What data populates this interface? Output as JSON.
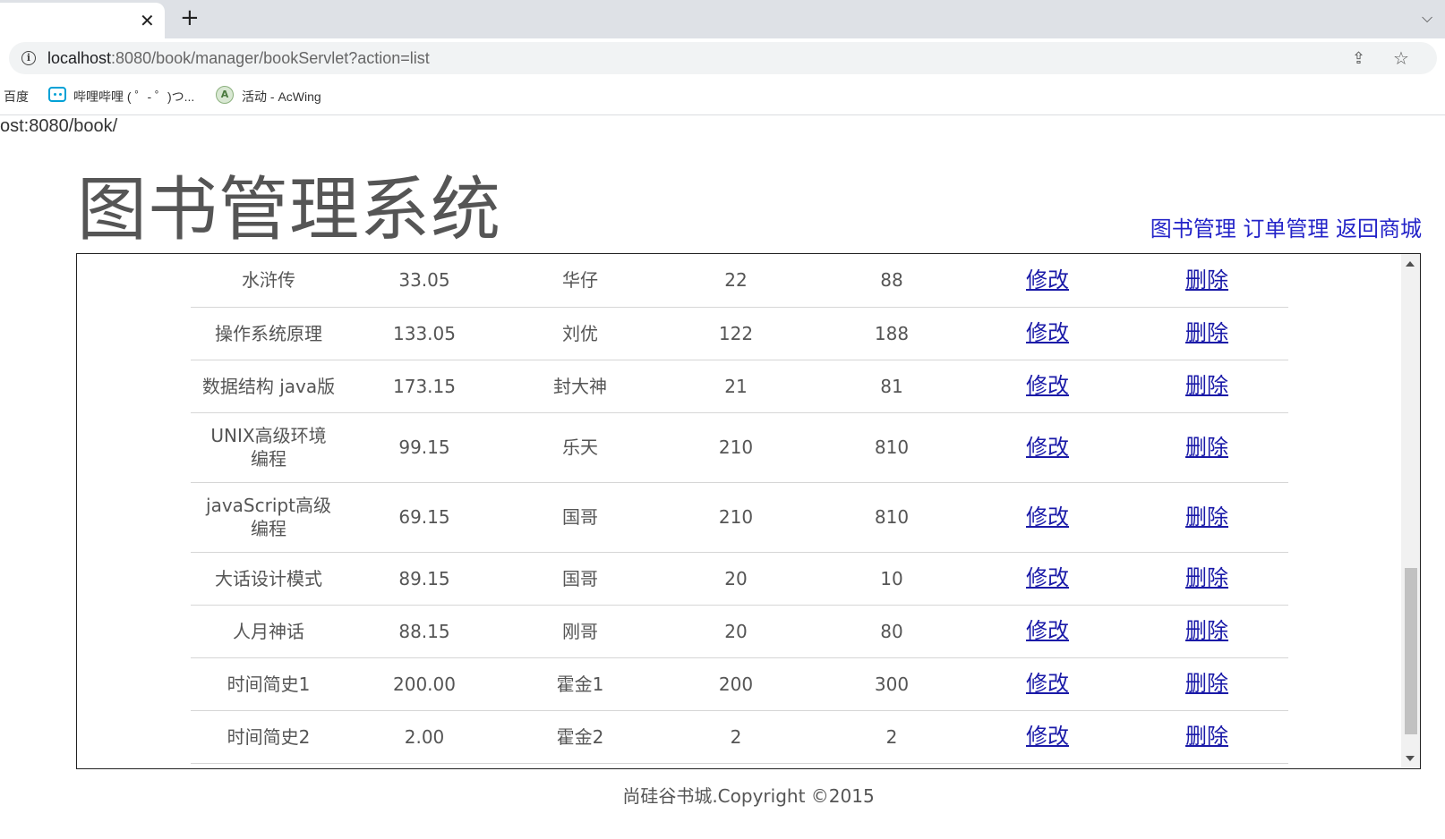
{
  "browser": {
    "tab_close": "✕",
    "new_tab": "+",
    "tab_menu": "⌵",
    "url_host": "localhost",
    "url_rest": ":8080/book/manager/bookServlet?action=list",
    "bookmarks": [
      {
        "label": "百度"
      },
      {
        "label": "哔哩哔哩 ( ゜- ゜)つ..."
      },
      {
        "label": "活动 - AcWing"
      }
    ]
  },
  "page": {
    "base_url": "ost:8080/book/",
    "title": "图书管理系统",
    "nav": {
      "book_manage": "图书管理",
      "order_manage": "订单管理",
      "back_to_store": "返回商城"
    },
    "edit_label": "修改",
    "delete_label": "删除",
    "footer": "尚硅谷书城.Copyright ©2015"
  },
  "books": [
    {
      "name": "水浒传",
      "price": "33.05",
      "author": "华仔",
      "sales": "22",
      "stock": "88"
    },
    {
      "name": "操作系统原理",
      "price": "133.05",
      "author": "刘优",
      "sales": "122",
      "stock": "188"
    },
    {
      "name": "数据结构 java版",
      "price": "173.15",
      "author": "封大神",
      "sales": "21",
      "stock": "81"
    },
    {
      "name": "UNIX高级环境编程",
      "price": "99.15",
      "author": "乐天",
      "sales": "210",
      "stock": "810"
    },
    {
      "name": "javaScript高级编程",
      "price": "69.15",
      "author": "国哥",
      "sales": "210",
      "stock": "810"
    },
    {
      "name": "大话设计模式",
      "price": "89.15",
      "author": "国哥",
      "sales": "20",
      "stock": "10"
    },
    {
      "name": "人月神话",
      "price": "88.15",
      "author": "刚哥",
      "sales": "20",
      "stock": "80"
    },
    {
      "name": "时间简史1",
      "price": "200.00",
      "author": "霍金1",
      "sales": "200",
      "stock": "300"
    },
    {
      "name": "时间简史2",
      "price": "2.00",
      "author": "霍金2",
      "sales": "2",
      "stock": "2"
    }
  ]
}
